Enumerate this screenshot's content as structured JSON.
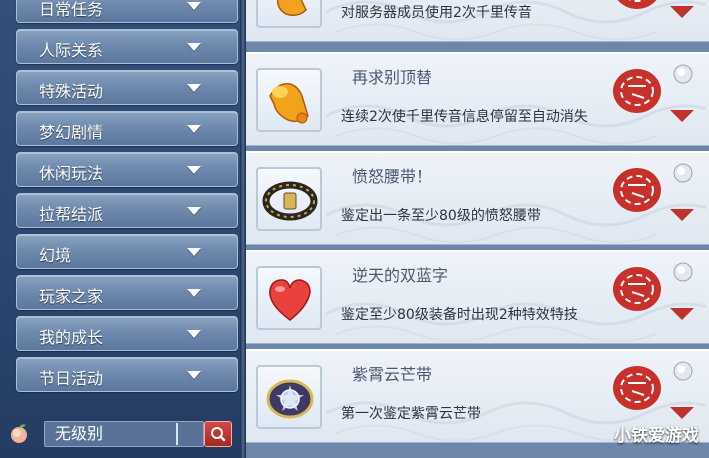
{
  "sidebar": {
    "categories": [
      {
        "label": "日常任务"
      },
      {
        "label": "人际关系"
      },
      {
        "label": "特殊活动"
      },
      {
        "label": "梦幻剧情"
      },
      {
        "label": "休闲玩法"
      },
      {
        "label": "拉帮结派"
      },
      {
        "label": "幻境"
      },
      {
        "label": "玩家之家"
      },
      {
        "label": "我的成长"
      },
      {
        "label": "节日活动"
      }
    ],
    "filter": {
      "value": "无级别",
      "icon": "peach-icon",
      "button_icon": "search-icon"
    }
  },
  "achievements": [
    {
      "title": "",
      "desc": "对服务器成员使用2次千里传音",
      "icon": "golden-horn-icon",
      "completed": true
    },
    {
      "title": "再求别顶替",
      "desc": "连续2次使千里传音信息停留至自动消失",
      "icon": "golden-horn-icon",
      "completed": true
    },
    {
      "title": "愤怒腰带！",
      "desc": "鉴定出一条至少80级的愤怒腰带",
      "icon": "belt-icon",
      "completed": true
    },
    {
      "title": "逆天的双蓝字",
      "desc": "鉴定至少80级装备时出现2种特效特技",
      "icon": "heart-icon",
      "completed": true
    },
    {
      "title": "紫霄云芒带",
      "desc": "第一次鉴定紫霄云芒带",
      "icon": "ornate-belt-icon",
      "completed": true
    }
  ],
  "colors": {
    "seal_red": "#c8302a",
    "accent_arrow": "#c0322c"
  },
  "watermark": "小铁爱游戏"
}
